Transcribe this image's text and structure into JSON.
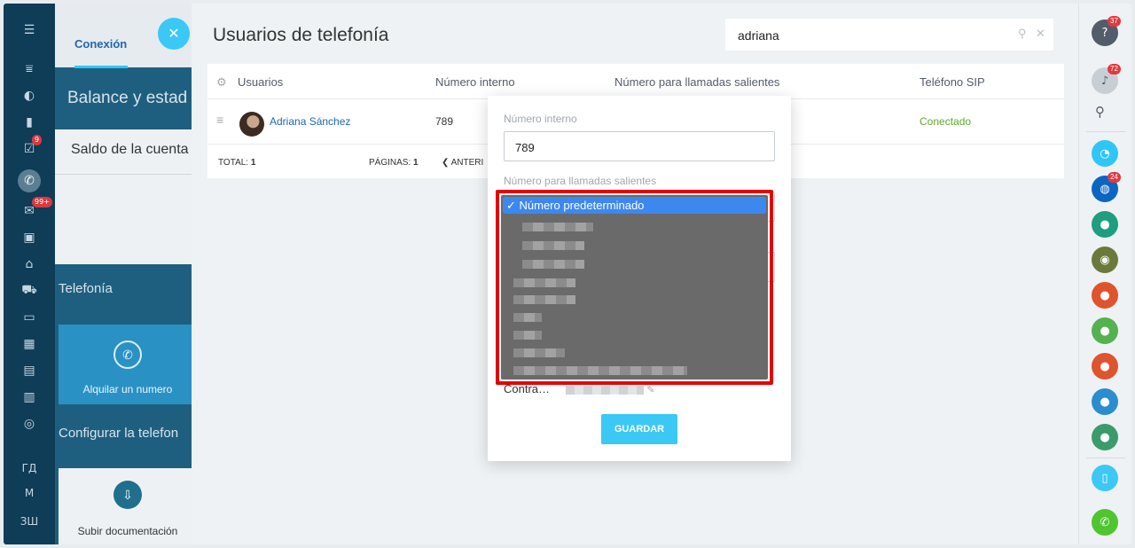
{
  "colors": {
    "accent": "#3bc8f5",
    "link": "#2067b0",
    "connected": "#5eaa2f",
    "sidebar": "#0f3c57",
    "highlight_frame": "#e60000",
    "dropdown_selected": "#3d88ef"
  },
  "left_sidebar": {
    "badges": {
      "tasks": "9",
      "mail": "99+"
    },
    "text_items": [
      "ГД",
      "М",
      "ЗШ"
    ]
  },
  "background_page": {
    "tab_label": "Conexión",
    "balance_heading": "Balance y estad",
    "card_title": "Saldo de la cuenta",
    "section_telefonia": "Telefonía",
    "rent_label": "Alquilar un numero",
    "section_config": "Configurar la telefon",
    "upload_label": "Subir documentación"
  },
  "main": {
    "title": "Usuarios de telefonía",
    "search_value": "adriana",
    "columns": [
      "Usuarios",
      "Número interno",
      "Número para llamadas salientes",
      "Teléfono SIP"
    ],
    "rows": [
      {
        "user": "Adriana Sánchez",
        "internal": "789",
        "sip": "Conectado"
      }
    ],
    "footer": {
      "total_label": "TOTAL:",
      "total_value": "1",
      "pages_label": "PÁGINAS:",
      "pages_value": "1",
      "prev_label": "ANTERI"
    }
  },
  "popup": {
    "internal_label": "Número interno",
    "internal_value": "789",
    "outgoing_label": "Número para llamadas salientes",
    "contract_label": "Contra…",
    "save_label": "GUARDAR",
    "dropdown_selected": "✓ Número predeterminado",
    "option_count_blurred": 9
  },
  "right_sidebar": {
    "badges": {
      "help": "37",
      "notifications": "72",
      "group": "24"
    }
  }
}
